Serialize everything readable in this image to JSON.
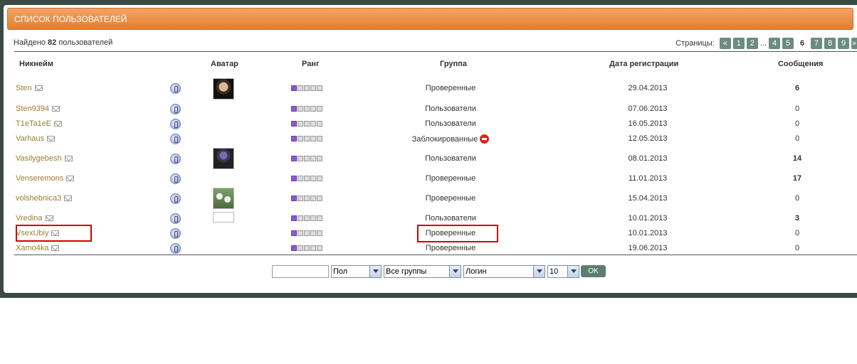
{
  "header": {
    "title": "СПИСОК ПОЛЬЗОВАТЕЛЕЙ"
  },
  "summary": {
    "prefix": "Найдено",
    "count": "82",
    "suffix": "пользователей"
  },
  "pager": {
    "label": "Страницы:",
    "prev": "«",
    "pages_a": [
      "1",
      "2"
    ],
    "dots": "...",
    "pages_b": [
      "4",
      "5",
      "6",
      "7",
      "8",
      "9"
    ],
    "current": "6",
    "next": "»"
  },
  "columns": {
    "nick": "Никнейм",
    "avatar": "Аватар",
    "rank": "Ранг",
    "group": "Группа",
    "date": "Дата регистрации",
    "messages": "Сообщения"
  },
  "rows": [
    {
      "nick": "Sten",
      "group": "Проверенные",
      "date": "29.04.2013",
      "messages": "6"
    },
    {
      "nick": "Sten9394",
      "group": "Пользователи",
      "date": "07.06.2013",
      "messages": "0"
    },
    {
      "nick": "T1eTa1eE",
      "group": "Пользователи",
      "date": "16.05.2013",
      "messages": "0"
    },
    {
      "nick": "Varhaus",
      "group": "Заблокированные",
      "date": "12.05.2013",
      "messages": "0"
    },
    {
      "nick": "Vasilygebesh",
      "group": "Пользователи",
      "date": "08.01.2013",
      "messages": "14"
    },
    {
      "nick": "Venseremons",
      "group": "Проверенные",
      "date": "11.01.2013",
      "messages": "17"
    },
    {
      "nick": "volshebnica3",
      "group": "Проверенные",
      "date": "15.04.2013",
      "messages": "0"
    },
    {
      "nick": "Vredina",
      "group": "Пользователи",
      "date": "10.01.2013",
      "messages": "3"
    },
    {
      "nick": "VsexUbiy",
      "group": "Проверенные",
      "date": "10.01.2013",
      "messages": "0"
    },
    {
      "nick": "Xamo4ka",
      "group": "Проверенные",
      "date": "19.06.2013",
      "messages": "0"
    }
  ],
  "filters": {
    "search_value": "",
    "gender": "Пол",
    "groups": "Все группы",
    "sort": "Логин",
    "per_page": "10",
    "ok": "OK"
  },
  "colors": {
    "header": "#e8893c",
    "accent": "#5d7d71",
    "highlight": "#d40000"
  }
}
